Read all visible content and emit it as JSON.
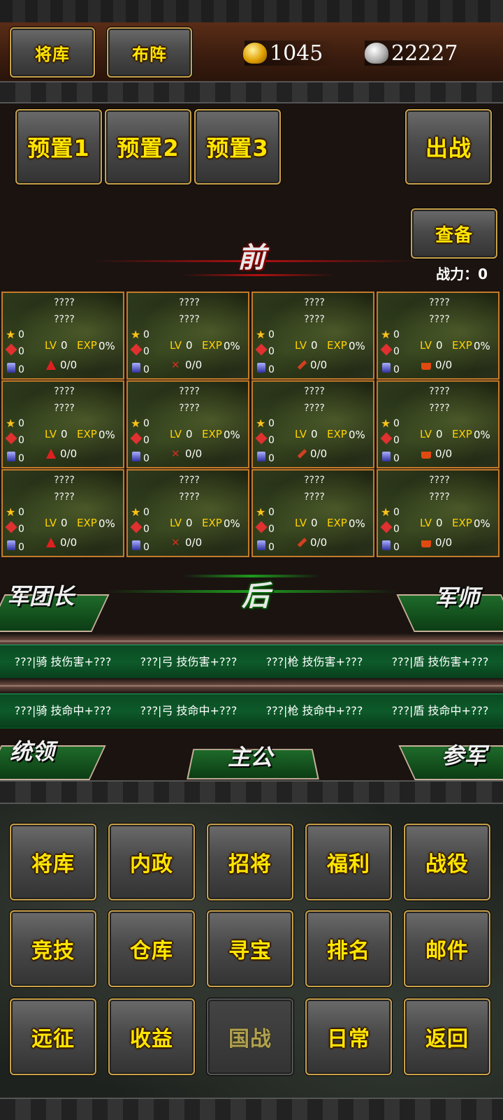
{
  "header": {
    "warehouse_label": "将库",
    "formation_label": "布阵",
    "gold": "1045",
    "silver": "22227"
  },
  "presets": [
    "预置1",
    "预置2",
    "预置3"
  ],
  "deploy_label": "出战",
  "check_label": "查备",
  "front_label": "前",
  "back_label": "后",
  "power_label": "战力：0",
  "cards": [
    {
      "name1": "????",
      "name2": "????",
      "star": "0",
      "lv_label": "LV",
      "lv": "0",
      "exp_label": "EXP",
      "exp": "0%",
      "atk": "0",
      "def": "0",
      "troop": "0/0",
      "type": "tri"
    },
    {
      "name1": "????",
      "name2": "????",
      "star": "0",
      "lv_label": "LV",
      "lv": "0",
      "exp_label": "EXP",
      "exp": "0%",
      "atk": "0",
      "def": "0",
      "troop": "0/0",
      "type": "x"
    },
    {
      "name1": "????",
      "name2": "????",
      "star": "0",
      "lv_label": "LV",
      "lv": "0",
      "exp_label": "EXP",
      "exp": "0%",
      "atk": "0",
      "def": "0",
      "troop": "0/0",
      "type": "spear"
    },
    {
      "name1": "????",
      "name2": "????",
      "star": "0",
      "lv_label": "LV",
      "lv": "0",
      "exp_label": "EXP",
      "exp": "0%",
      "atk": "0",
      "def": "0",
      "troop": "0/0",
      "type": "box"
    },
    {
      "name1": "????",
      "name2": "????",
      "star": "0",
      "lv_label": "LV",
      "lv": "0",
      "exp_label": "EXP",
      "exp": "0%",
      "atk": "0",
      "def": "0",
      "troop": "0/0",
      "type": "tri"
    },
    {
      "name1": "????",
      "name2": "????",
      "star": "0",
      "lv_label": "LV",
      "lv": "0",
      "exp_label": "EXP",
      "exp": "0%",
      "atk": "0",
      "def": "0",
      "troop": "0/0",
      "type": "x"
    },
    {
      "name1": "????",
      "name2": "????",
      "star": "0",
      "lv_label": "LV",
      "lv": "0",
      "exp_label": "EXP",
      "exp": "0%",
      "atk": "0",
      "def": "0",
      "troop": "0/0",
      "type": "spear"
    },
    {
      "name1": "????",
      "name2": "????",
      "star": "0",
      "lv_label": "LV",
      "lv": "0",
      "exp_label": "EXP",
      "exp": "0%",
      "atk": "0",
      "def": "0",
      "troop": "0/0",
      "type": "box"
    },
    {
      "name1": "????",
      "name2": "????",
      "star": "0",
      "lv_label": "LV",
      "lv": "0",
      "exp_label": "EXP",
      "exp": "0%",
      "atk": "0",
      "def": "0",
      "troop": "0/0",
      "type": "tri"
    },
    {
      "name1": "????",
      "name2": "????",
      "star": "0",
      "lv_label": "LV",
      "lv": "0",
      "exp_label": "EXP",
      "exp": "0%",
      "atk": "0",
      "def": "0",
      "troop": "0/0",
      "type": "x"
    },
    {
      "name1": "????",
      "name2": "????",
      "star": "0",
      "lv_label": "LV",
      "lv": "0",
      "exp_label": "EXP",
      "exp": "0%",
      "atk": "0",
      "def": "0",
      "troop": "0/0",
      "type": "spear"
    },
    {
      "name1": "????",
      "name2": "????",
      "star": "0",
      "lv_label": "LV",
      "lv": "0",
      "exp_label": "EXP",
      "exp": "0%",
      "atk": "0",
      "def": "0",
      "troop": "0/0",
      "type": "box"
    }
  ],
  "roles": {
    "legion_leader": "军团长",
    "strategist": "军师",
    "commander": "统领",
    "lord": "主公",
    "adviser": "参军"
  },
  "damage_bonuses": [
    "???|骑 技伤害+???",
    "???|弓 技伤害+???",
    "???|枪 技伤害+???",
    "???|盾 技伤害+???"
  ],
  "hit_bonuses": [
    "???|骑 技命中+???",
    "???|弓 技命中+???",
    "???|枪 技命中+???",
    "???|盾 技命中+???"
  ],
  "menu": [
    {
      "label": "将库",
      "enabled": true
    },
    {
      "label": "内政",
      "enabled": true
    },
    {
      "label": "招将",
      "enabled": true
    },
    {
      "label": "福利",
      "enabled": true
    },
    {
      "label": "战役",
      "enabled": true
    },
    {
      "label": "竞技",
      "enabled": true
    },
    {
      "label": "仓库",
      "enabled": true
    },
    {
      "label": "寻宝",
      "enabled": true
    },
    {
      "label": "排名",
      "enabled": true
    },
    {
      "label": "邮件",
      "enabled": true
    },
    {
      "label": "远征",
      "enabled": true
    },
    {
      "label": "收益",
      "enabled": true
    },
    {
      "label": "国战",
      "enabled": false
    },
    {
      "label": "日常",
      "enabled": true
    },
    {
      "label": "返回",
      "enabled": true
    }
  ]
}
